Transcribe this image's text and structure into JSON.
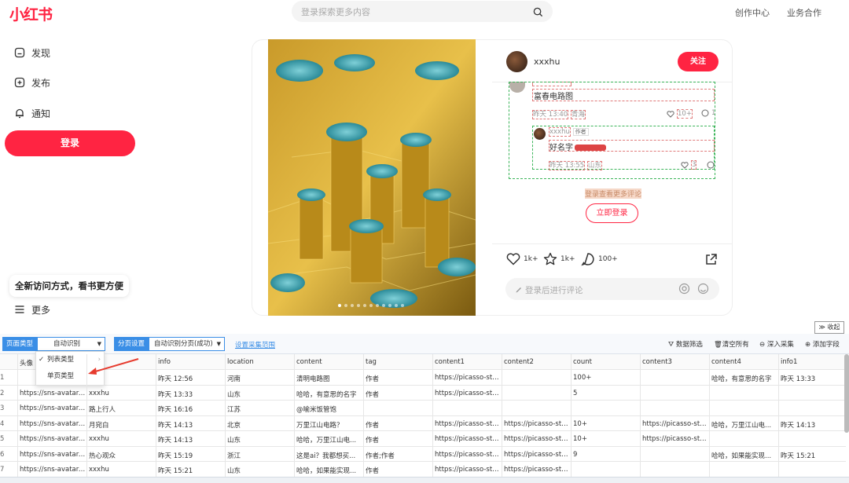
{
  "header": {
    "logo": "小红书",
    "search_placeholder": "登录探索更多内容",
    "nav": [
      "创作中心",
      "业务合作"
    ]
  },
  "sidebar": {
    "items": [
      {
        "label": "发现",
        "icon": "home-icon"
      },
      {
        "label": "发布",
        "icon": "plus-square-icon"
      },
      {
        "label": "通知",
        "icon": "bell-icon"
      }
    ],
    "login_label": "登录",
    "promo": "全新访问方式，看书更方便",
    "more_label": "更多"
  },
  "note": {
    "author": "xxxhu",
    "follow_label": "关注",
    "comment1": {
      "text": "富春电路图",
      "time": "昨天 13:40",
      "location": "青海",
      "likes": "10+",
      "replies": "1"
    },
    "comment2": {
      "user": "xxxhu",
      "badge": "作者",
      "text": "好名字",
      "time": "昨天 13:55",
      "location": "山东",
      "likes": "3"
    },
    "more_comments": "登录查看更多评论",
    "login_now": "立即登录",
    "likes": "1k+",
    "collects": "1k+",
    "comments": "100+",
    "comment_placeholder": "登录后进行评论",
    "carousel_dots": 11
  },
  "panel": {
    "collapse_label": "收起",
    "page_type_label": "页面类型",
    "page_type_value": "自动识别",
    "paging_label": "分页设置",
    "paging_value": "自动识别分页(成功)",
    "scope_link": "设置采集范围",
    "tools": [
      "数据筛选",
      "清空所有",
      "深入采集",
      "添加字段"
    ],
    "dropdown": [
      "列表类型",
      "单页类型"
    ],
    "columns": [
      "头像",
      "",
      "info",
      "location",
      "content",
      "tag",
      "content1",
      "content2",
      "count",
      "content3",
      "content4",
      "info1"
    ],
    "rows": [
      [
        "1",
        "",
        "",
        "昨天 12:56",
        "河南",
        "清明电路图",
        "作者",
        "https://picasso-stati...",
        "",
        "100+",
        "",
        "哈哈，有意思的名字",
        "昨天 13:33"
      ],
      [
        "2",
        "https://sns-avatar-q...",
        "xxxhu",
        "昨天 13:33",
        "山东",
        "哈哈，有意思的名字",
        "作者",
        "https://picasso-stati...",
        "",
        "5",
        "",
        "",
        ""
      ],
      [
        "3",
        "https://sns-avatar-q...",
        "路上行人",
        "昨天 16:16",
        "江苏",
        "@喻米饭管饱",
        "",
        "",
        "",
        "",
        "",
        "",
        ""
      ],
      [
        "4",
        "https://sns-avatar-q...",
        "月宛白",
        "昨天 14:13",
        "北京",
        "万里江山电路？",
        "作者",
        "https://picasso-stati...",
        "https://picasso-stati...",
        "10+",
        "https://picasso-stati...",
        "哈哈，万里江山电...",
        "昨天 14:13"
      ],
      [
        "5",
        "https://sns-avatar-q...",
        "xxxhu",
        "昨天 14:13",
        "山东",
        "哈哈，万里江山电...",
        "作者",
        "https://picasso-stati...",
        "https://picasso-stati...",
        "10+",
        "https://picasso-stati...",
        "",
        ""
      ],
      [
        "6",
        "https://sns-avatar-q...",
        "热心观众",
        "昨天 15:19",
        "浙江",
        "这是ai？我都想买...",
        "作者;作者",
        "https://picasso-stati...",
        "https://picasso-stati...",
        "9",
        "",
        "哈哈，如果能实现...",
        "昨天 15:21"
      ],
      [
        "7",
        "https://sns-avatar-q...",
        "xxxhu",
        "昨天 15:21",
        "山东",
        "哈哈，如果能实现...",
        "作者",
        "https://picasso-stati...",
        "https://picasso-stati...",
        "",
        "",
        "",
        ""
      ]
    ]
  }
}
